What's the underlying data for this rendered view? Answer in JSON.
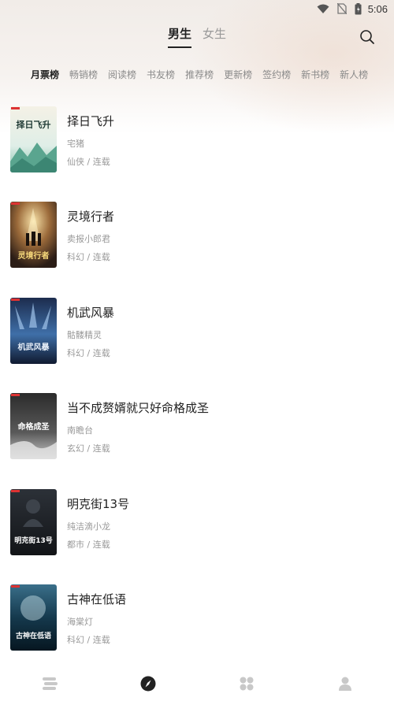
{
  "status_bar": {
    "time": "5:06",
    "icons": [
      "wifi-icon",
      "no-sim-icon",
      "battery-icon"
    ]
  },
  "gender_tabs": [
    {
      "label": "男生",
      "active": true
    },
    {
      "label": "女生",
      "active": false
    }
  ],
  "search": {
    "icon": "search-icon"
  },
  "rank_tabs": [
    {
      "label": "月票榜",
      "active": true
    },
    {
      "label": "畅销榜"
    },
    {
      "label": "阅读榜"
    },
    {
      "label": "书友榜"
    },
    {
      "label": "推荐榜"
    },
    {
      "label": "更新榜"
    },
    {
      "label": "签约榜"
    },
    {
      "label": "新书榜"
    },
    {
      "label": "新人榜"
    }
  ],
  "books": [
    {
      "title": "择日飞升",
      "author": "宅猪",
      "meta": "仙侠 / 连载",
      "cover_text": "择日飞升"
    },
    {
      "title": "灵境行者",
      "author": "卖报小郎君",
      "meta": "科幻 / 连载",
      "cover_text": "灵境行者"
    },
    {
      "title": "机武风暴",
      "author": "骷髅精灵",
      "meta": "科幻 / 连载",
      "cover_text": "机武风暴"
    },
    {
      "title": "当不成赘婿就只好命格成圣",
      "author": "南瞻台",
      "meta": "玄幻 / 连载",
      "cover_text": "命格成圣"
    },
    {
      "title": "明克街13号",
      "author": "纯洁滴小龙",
      "meta": "都市 / 连载",
      "cover_text": "明克街13号"
    },
    {
      "title": "古神在低语",
      "author": "海棠灯",
      "meta": "科幻 / 连载",
      "cover_text": "古神在低语"
    }
  ],
  "bottom_nav": [
    {
      "name": "bookshelf-icon",
      "active": false
    },
    {
      "name": "discover-compass-icon",
      "active": true
    },
    {
      "name": "category-grid-icon",
      "active": false
    },
    {
      "name": "profile-icon",
      "active": false
    }
  ],
  "colors": {
    "text_primary": "#222222",
    "text_secondary": "#999999",
    "header_bg": "#f3eeea"
  }
}
